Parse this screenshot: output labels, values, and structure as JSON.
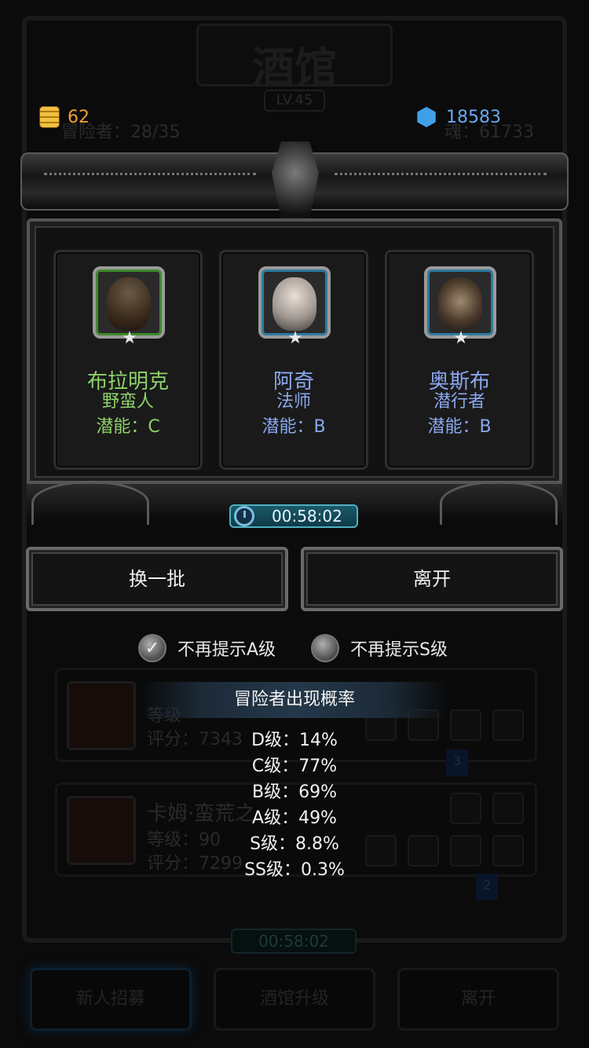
{
  "background": {
    "title": "酒馆",
    "level": "LV.45",
    "adventurers": "冒险者：28/35",
    "souls": "魂：61733",
    "list_items": [
      {
        "name": "",
        "level": "等级",
        "score": "评分：7343",
        "tag": "3"
      },
      {
        "name": "卡姆·蛮荒之",
        "level": "等级：90",
        "score": "评分：7299",
        "tag": "2"
      }
    ],
    "timer": "00:58:02",
    "buttons": [
      "新人招募",
      "酒馆升级",
      "离开"
    ]
  },
  "currency": {
    "gold": "62",
    "gems": "18583",
    "gold_icon": "gold-coin-stack-icon",
    "gem_icon": "blue-gem-icon"
  },
  "modal": {
    "heroes": [
      {
        "name": "布拉明克",
        "class": "野蛮人",
        "potential": "潜能：C",
        "color": "#8ed36a",
        "frame": "green",
        "icon": "dwarf-barbarian-portrait"
      },
      {
        "name": "阿奇",
        "class": "法师",
        "potential": "潜能：B",
        "color": "#8aa8f0",
        "frame": "blue",
        "icon": "masked-mage-portrait"
      },
      {
        "name": "奥斯布",
        "class": "潜行者",
        "potential": "潜能：B",
        "color": "#8aa8f0",
        "frame": "blue",
        "icon": "hooded-rogue-portrait"
      }
    ],
    "timer": "00:58:02",
    "refresh_label": "换一批",
    "leave_label": "离开",
    "checkbox_a": {
      "label": "不再提示A级",
      "checked": true
    },
    "checkbox_s": {
      "label": "不再提示S级",
      "checked": false
    },
    "probability": {
      "title": "冒险者出现概率",
      "rows": [
        "D级：14%",
        "C级：77%",
        "B级：69%",
        "A级：49%",
        "S级：8.8%",
        "SS级：0.3%"
      ]
    }
  }
}
